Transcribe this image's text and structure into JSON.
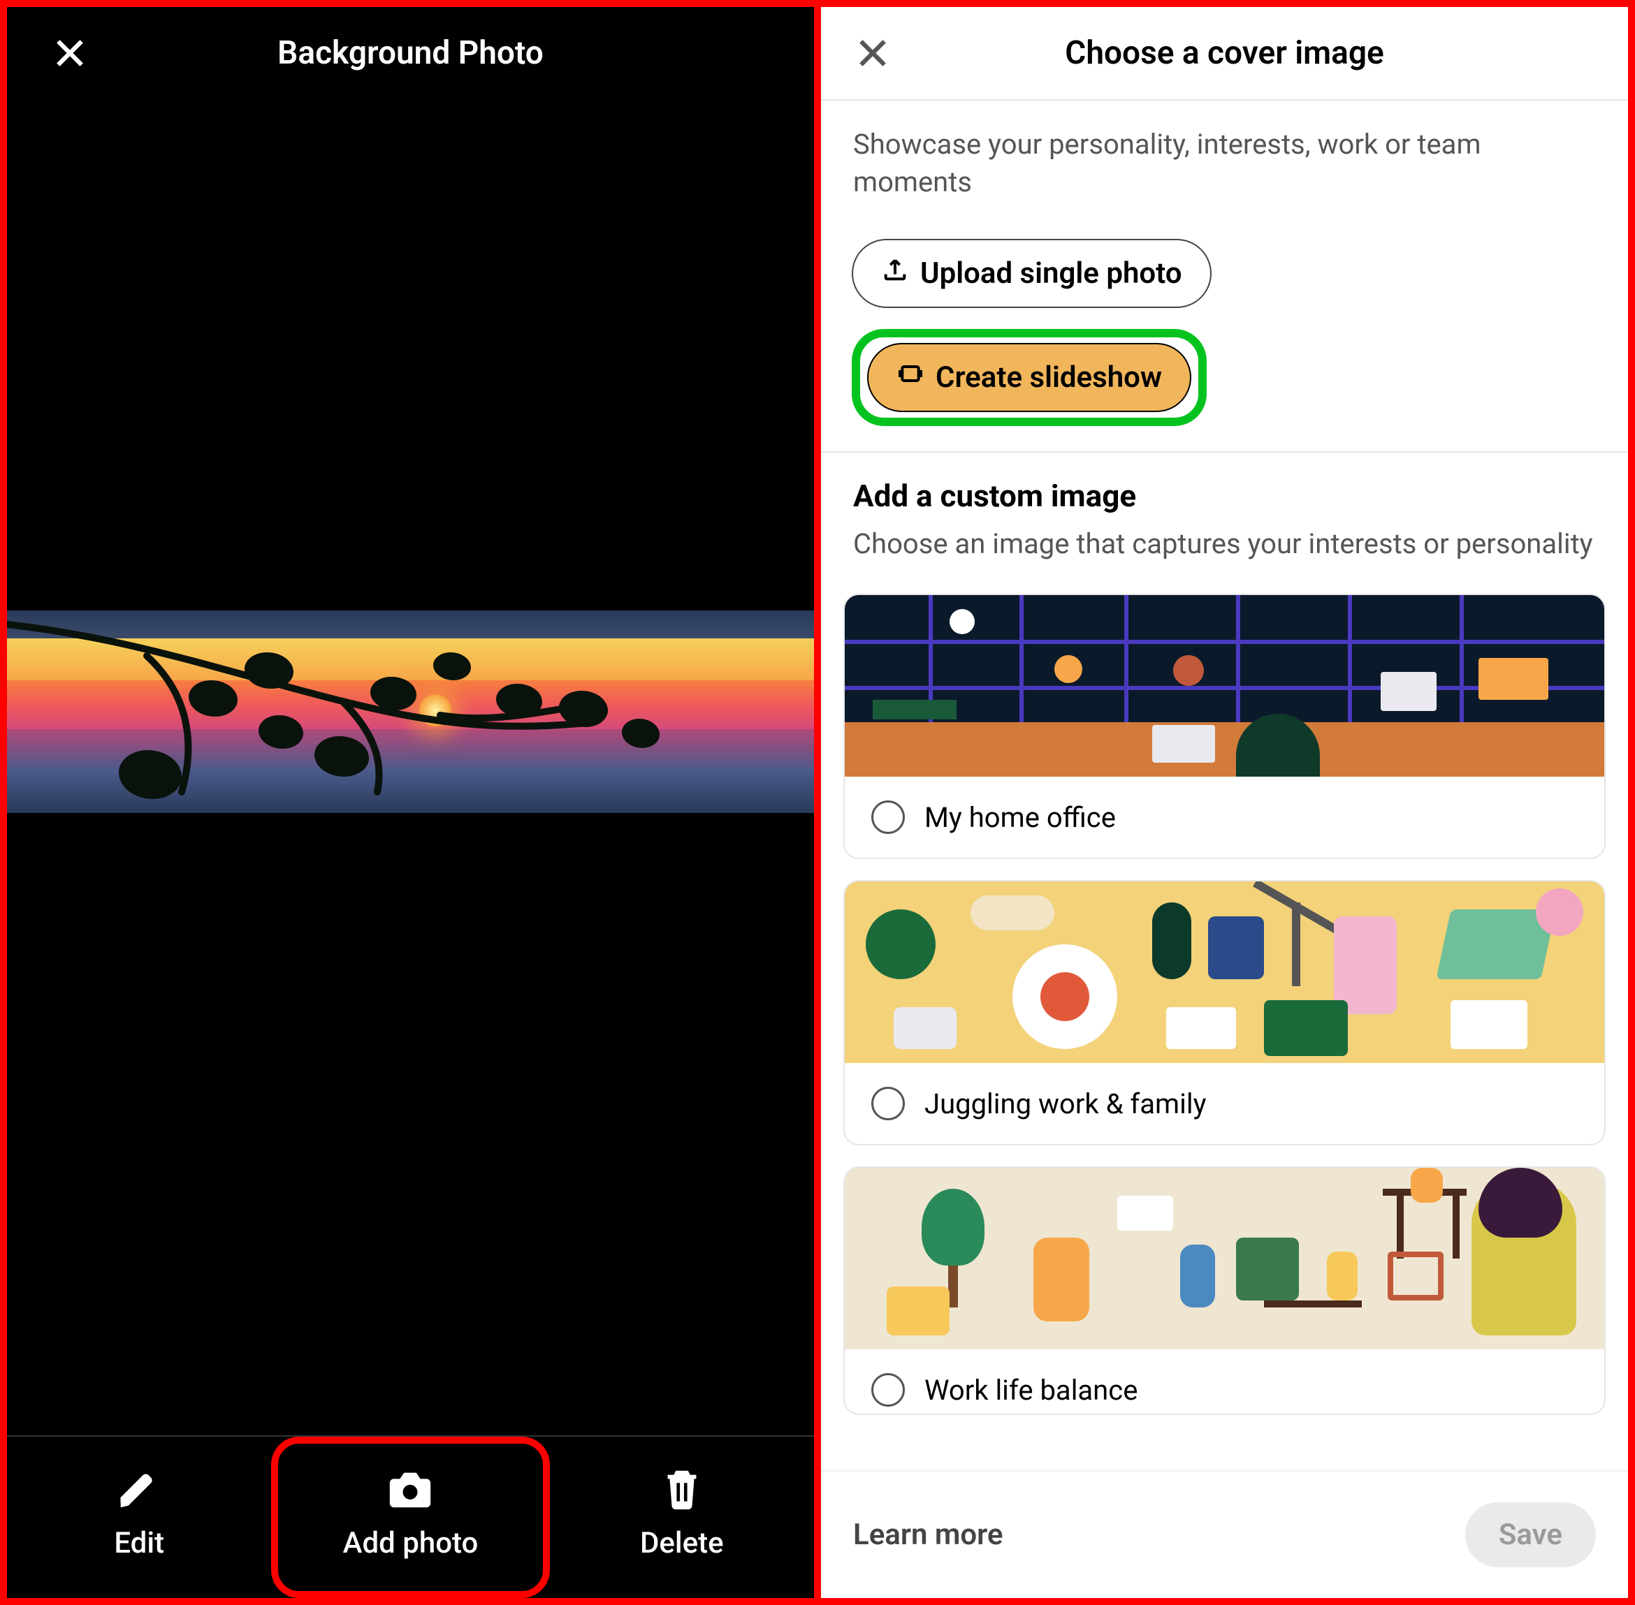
{
  "left": {
    "title": "Background Photo",
    "actions": {
      "edit": "Edit",
      "add_photo": "Add photo",
      "delete": "Delete"
    }
  },
  "right": {
    "title": "Choose a cover image",
    "subtitle": "Showcase your personality, interests, work or team moments",
    "upload_label": "Upload single photo",
    "slideshow_label": "Create slideshow",
    "custom_heading": "Add a custom image",
    "custom_desc": "Choose an image that captures your interests or personality",
    "options": [
      {
        "label": "My home office"
      },
      {
        "label": "Juggling work & family"
      },
      {
        "label": "Work life balance"
      }
    ],
    "learn_more": "Learn more",
    "save": "Save"
  }
}
